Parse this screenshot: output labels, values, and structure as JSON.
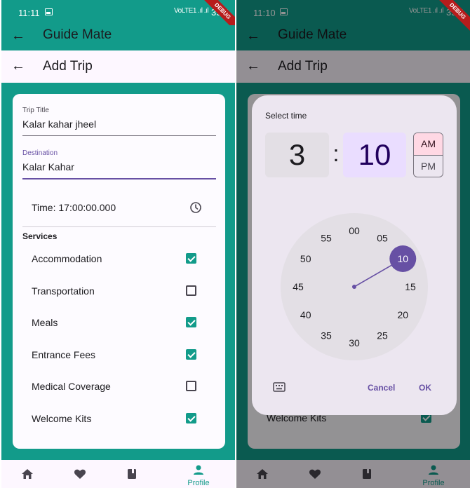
{
  "left": {
    "status": {
      "time": "11:11",
      "signal": "VoLTE1 .ıl .ıl",
      "battery": "39%"
    },
    "debug_label": "DEBUG",
    "appbar_title": "Guide Mate",
    "subbar_title": "Add Trip",
    "form": {
      "trip_title_label": "Trip Title",
      "trip_title_value": "Kalar kahar jheel",
      "destination_label": "Destination",
      "destination_value": "Kalar Kahar",
      "time_text": "Time: 17:00:00.000",
      "services_title": "Services"
    },
    "services": [
      {
        "name": "Accommodation",
        "checked": true
      },
      {
        "name": "Transportation",
        "checked": false
      },
      {
        "name": "Meals",
        "checked": true
      },
      {
        "name": "Entrance Fees",
        "checked": true
      },
      {
        "name": "Medical Coverage",
        "checked": false
      },
      {
        "name": "Welcome Kits",
        "checked": true
      }
    ],
    "nav": {
      "profile_label": "Profile"
    }
  },
  "right": {
    "status": {
      "time": "11:10",
      "signal": "VoLTE1 .ıl .ıl",
      "battery": "39%"
    },
    "debug_label": "DEBUG",
    "appbar_title": "Guide Mate",
    "subbar_title": "Add Trip",
    "behind_service": "Welcome Kits",
    "nav": {
      "profile_label": "Profile"
    },
    "time_picker": {
      "title": "Select time",
      "hour": "3",
      "separator": ":",
      "minute": "10",
      "am_label": "AM",
      "pm_label": "PM",
      "selected_period": "AM",
      "dial_numbers": [
        "00",
        "05",
        "10",
        "15",
        "20",
        "25",
        "30",
        "35",
        "40",
        "45",
        "50",
        "55"
      ],
      "selected_minute": 10,
      "cancel_label": "Cancel",
      "ok_label": "OK"
    }
  },
  "colors": {
    "teal_primary": "#129b8a",
    "purple_accent": "#6750a4",
    "dialog_bg": "#ece6f0",
    "minute_highlight": "#eaddff",
    "am_highlight": "#ffd8e4"
  }
}
